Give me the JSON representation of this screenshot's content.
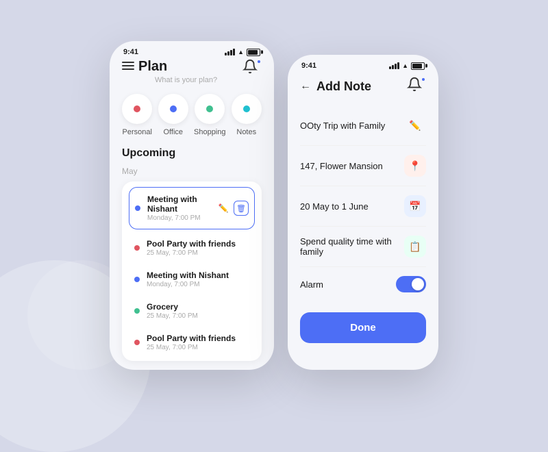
{
  "app": {
    "status_time": "9:41",
    "title": "Plan",
    "subtitle": "What is your plan?",
    "upcoming_label": "Upcoming",
    "month_label": "May",
    "notification_label": "bell"
  },
  "categories": [
    {
      "id": "personal",
      "label": "Personal",
      "color": "#e05560"
    },
    {
      "id": "office",
      "label": "Office",
      "color": "#4d6ef5"
    },
    {
      "id": "shopping",
      "label": "Shopping",
      "color": "#40c090"
    },
    {
      "id": "notes",
      "label": "Notes",
      "color": "#20c0d0"
    }
  ],
  "events": [
    {
      "name": "Meeting with Nishant",
      "time": "Monday, 7:00 PM",
      "color": "#4d6ef5",
      "highlighted": true
    },
    {
      "name": "Pool Party with friends",
      "time": "25 May, 7:00 PM",
      "color": "#e05560",
      "highlighted": false
    },
    {
      "name": "Meeting with Nishant",
      "time": "Monday, 7:00 PM",
      "color": "#4d6ef5",
      "highlighted": false
    },
    {
      "name": "Grocery",
      "time": "25 May, 7:00 PM",
      "color": "#40c090",
      "highlighted": false
    },
    {
      "name": "Pool Party with friends",
      "time": "25 May, 7:00 PM",
      "color": "#e05560",
      "highlighted": false
    }
  ],
  "add_note": {
    "title": "Add Note",
    "back_label": "←",
    "fields": [
      {
        "id": "trip-name",
        "value": "OOty Trip with Family",
        "icon_type": "edit"
      },
      {
        "id": "address",
        "value": "147, Flower Mansion",
        "icon_type": "loc"
      },
      {
        "id": "date-range",
        "value": "20 May to 1 June",
        "icon_type": "cal"
      },
      {
        "id": "description",
        "value": "Spend quality time with family",
        "icon_type": "note"
      }
    ],
    "alarm_label": "Alarm",
    "done_label": "Done"
  }
}
